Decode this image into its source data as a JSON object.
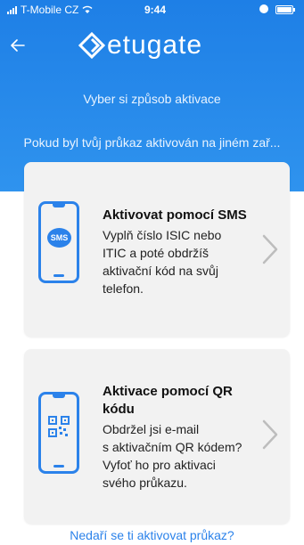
{
  "status_bar": {
    "carrier": "T-Mobile CZ",
    "time": "9:44"
  },
  "header": {
    "logo_text": "etugate",
    "subtitle": "Vyber si způsob aktivace",
    "info_text": "Pokud byl tvůj průkaz aktivován na jiném zař..."
  },
  "cards": [
    {
      "title": "Aktivovat pomocí SMS",
      "description": [
        "Vyplň číslo ISIC nebo",
        "ITIC a poté obdržíš",
        "aktivační kód na svůj",
        "telefon."
      ],
      "icon_label": "SMS"
    },
    {
      "title_lines": [
        "Aktivace pomocí QR",
        "kódu"
      ],
      "description": [
        "Obdržel jsi e-mail",
        "s aktivačním QR kódem?",
        "Vyfoť ho pro aktivaci",
        "svého průkazu."
      ]
    }
  ],
  "footer": {
    "help_link": "Nedaří se ti aktivovat průkaz?"
  },
  "colors": {
    "accent": "#2b82ea",
    "header_top": "#1e7fe6",
    "card_bg": "#f2f2f2"
  }
}
